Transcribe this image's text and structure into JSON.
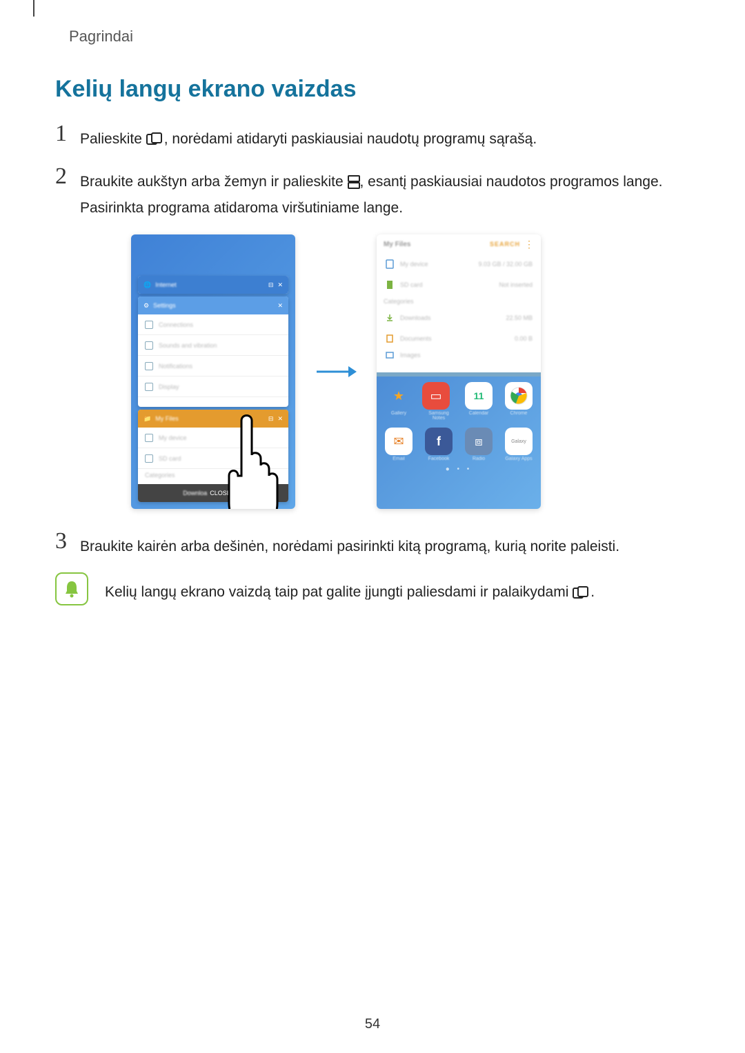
{
  "header": {
    "section": "Pagrindai"
  },
  "title": "Kelių langų ekrano vaizdas",
  "steps": {
    "s1": {
      "num": "1",
      "pre": "Palieskite ",
      "post": ", norėdami atidaryti paskiausiai naudotų programų sąrašą."
    },
    "s2": {
      "num": "2",
      "pre": "Braukite aukštyn arba žemyn ir palieskite ",
      "post": ", esantį paskiausiai naudotos programos lange. Pasirinkta programa atidaroma viršutiniame lange."
    },
    "s3": {
      "num": "3",
      "text": "Braukite kairėn arba dešinėn, norėdami pasirinkti kitą programą, kurią norite paleisti."
    }
  },
  "tip": {
    "pre": "Kelių langų ekrano vaizdą taip pat galite įjungti paliesdami ir palaikydami ",
    "post": "."
  },
  "page_number": "54",
  "figure": {
    "left": {
      "cards": [
        {
          "title": "Internet",
          "color": "blue"
        },
        {
          "title": "Settings",
          "color": "lblue",
          "rows": [
            "Connections",
            "Sounds and vibration",
            "Notifications",
            "Display"
          ]
        },
        {
          "title": "My Files",
          "color": "orange",
          "rows": [
            "My device",
            "SD card"
          ],
          "category": "Categories",
          "extra": "Downloa"
        }
      ],
      "close_all": "CLOSE ALL"
    },
    "right": {
      "top_title": "My Files",
      "search": "SEARCH",
      "storage": [
        {
          "name": "My device",
          "meta": "9.03 GB / 32.00 GB"
        },
        {
          "name": "SD card",
          "meta": "Not inserted"
        }
      ],
      "categories_label": "Categories",
      "cats": [
        {
          "name": "Downloads",
          "meta": "22.50 MB"
        },
        {
          "name": "Documents",
          "meta": "0.00 B"
        },
        {
          "name": "Images",
          "meta": ""
        }
      ],
      "apps": [
        {
          "name": "Gallery",
          "bg": "#fff",
          "glyph": "★",
          "gc": "#f5a623"
        },
        {
          "name": "Samsung Notes",
          "bg": "#e84c3d",
          "glyph": "▭",
          "gc": "#fff"
        },
        {
          "name": "Calendar",
          "bg": "#fff",
          "glyph": "11",
          "gc": "#2b7"
        },
        {
          "name": "Chrome",
          "bg": "#fff",
          "glyph": "◉",
          "gc": "#3b8"
        },
        {
          "name": "Email",
          "bg": "#fff",
          "glyph": "✉",
          "gc": "#e67e22"
        },
        {
          "name": "Facebook",
          "bg": "#3b5998",
          "glyph": "f",
          "gc": "#fff"
        },
        {
          "name": "Radio",
          "bg": "#6a8bb5",
          "glyph": "⧈",
          "gc": "#fff"
        },
        {
          "name": "Galaxy Apps",
          "bg": "#fff",
          "glyph": "Galaxy",
          "gc": "#888"
        }
      ]
    }
  }
}
